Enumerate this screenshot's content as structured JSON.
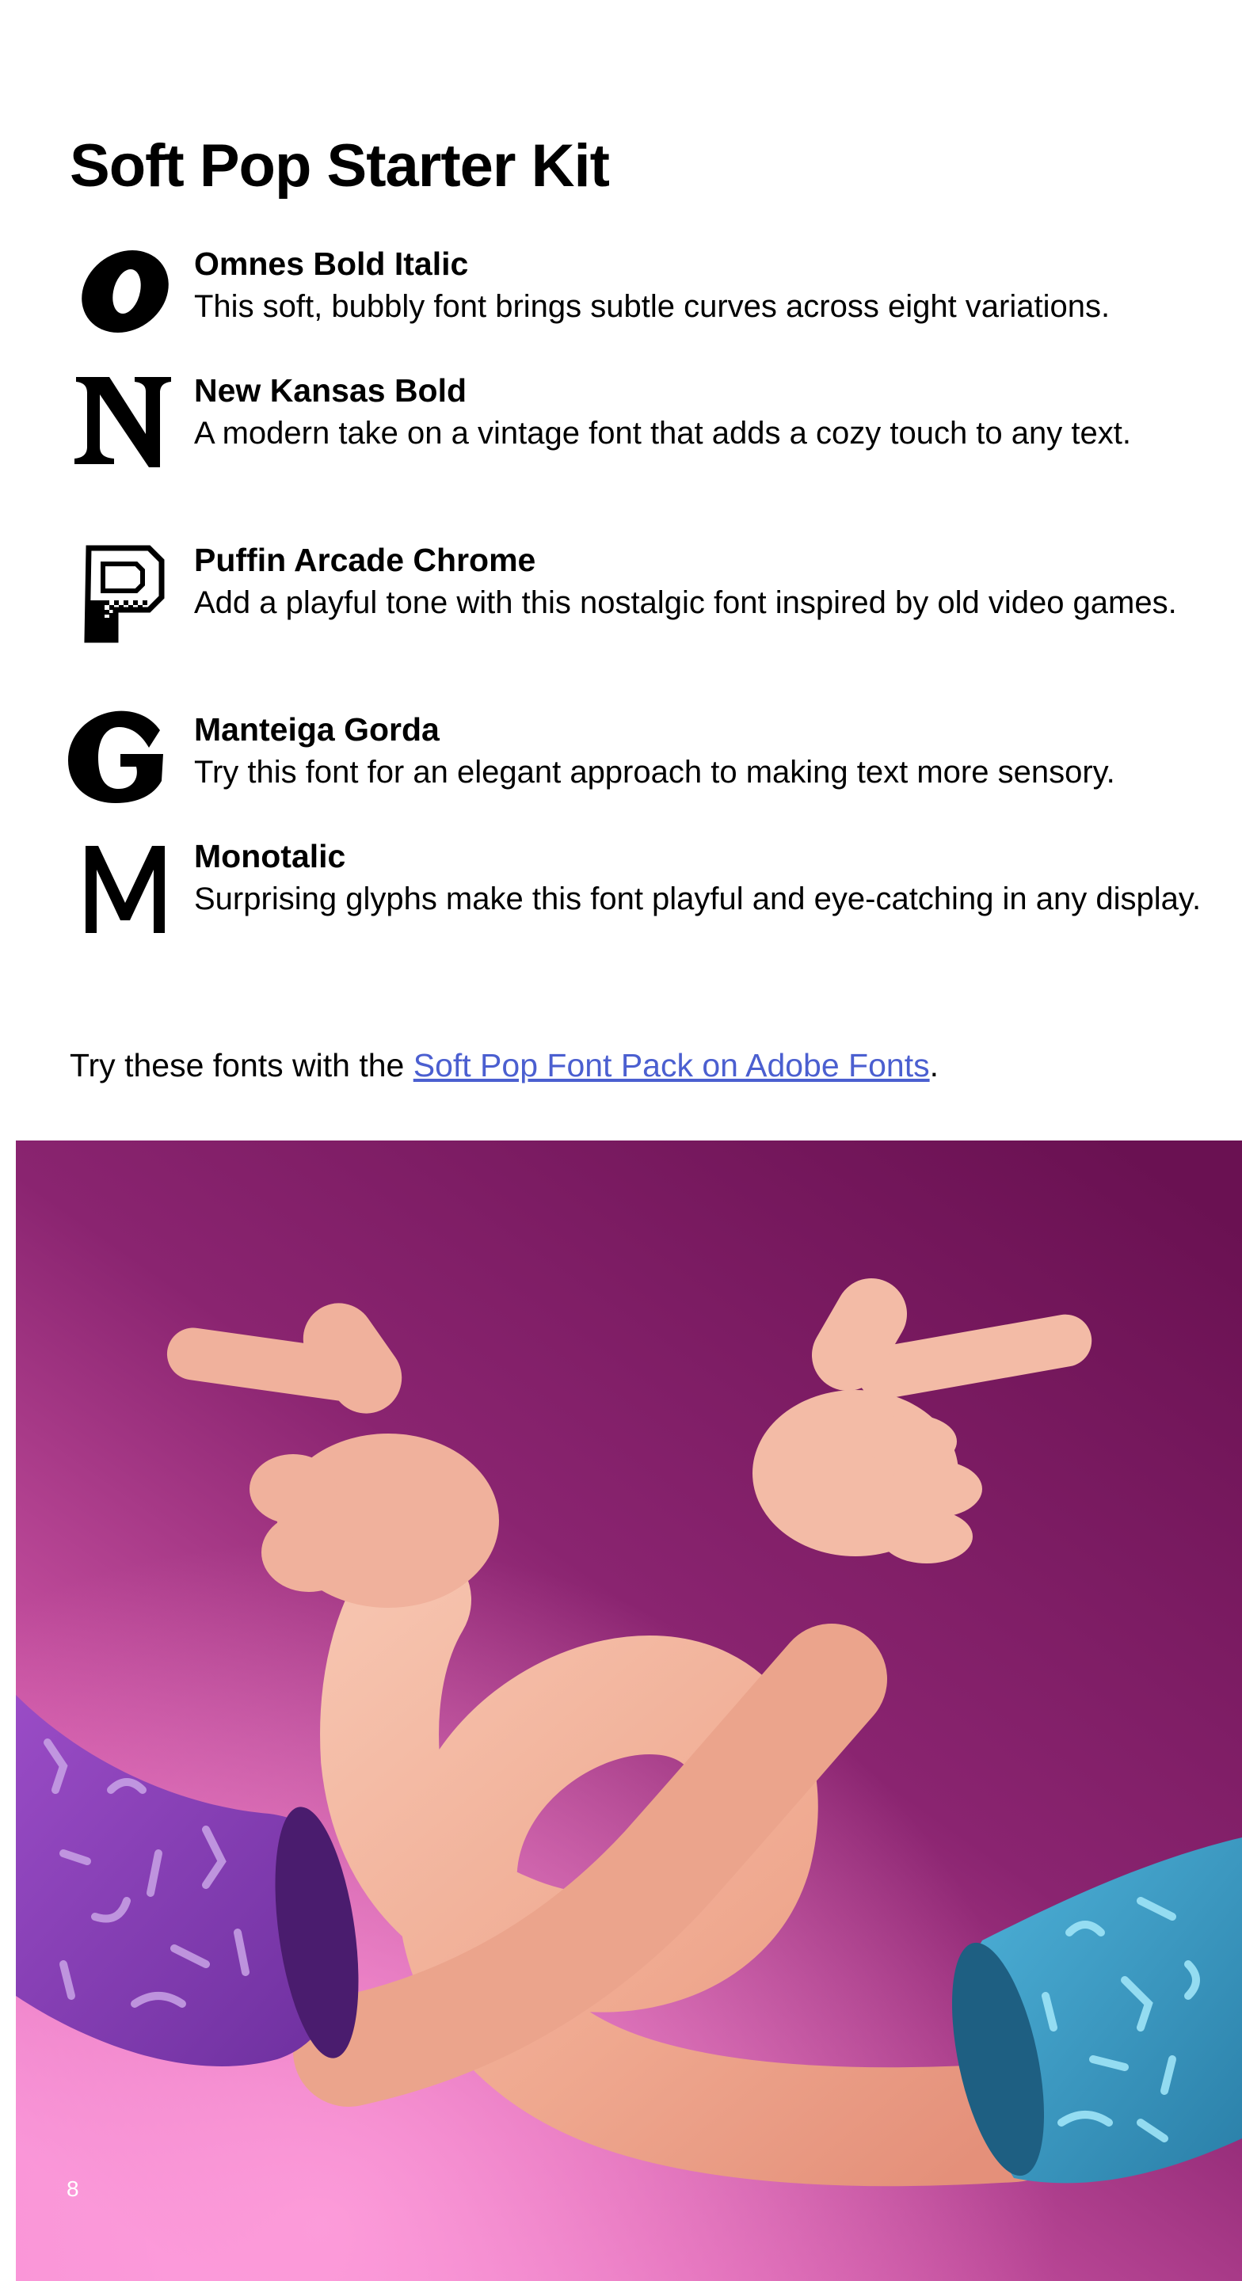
{
  "page": {
    "title": "Soft Pop Starter Kit",
    "page_number": "8"
  },
  "fonts": [
    {
      "glyph": "O",
      "name": "Omnes Bold Italic",
      "description": "This soft, bubbly font brings subtle curves across eight variations."
    },
    {
      "glyph": "N",
      "name": "New Kansas Bold",
      "description": "A modern take on a vintage font that adds a cozy touch to any text."
    },
    {
      "glyph": "P",
      "name": "Puffin Arcade Chrome",
      "description": "Add a playful tone with this nostalgic font inspired by old video games."
    },
    {
      "glyph": "G",
      "name": "Manteiga Gorda",
      "description": "Try this font for an elegant approach to making text more sensory."
    },
    {
      "glyph": "M",
      "name": "Monotalic",
      "description": "Surprising glyphs make this font playful and eye-catching in any display."
    }
  ],
  "cta": {
    "prefix": "Try these fonts with the ",
    "link_text": "Soft Pop Font Pack on Adobe Fonts",
    "suffix": "."
  },
  "colors": {
    "link": "#4b5fd0",
    "background_top": "#6e1456",
    "background_bottom": "#f28ad2",
    "skin": "#f2b09c",
    "left_sleeve": "#8a3fb8",
    "right_sleeve": "#3a9bc4"
  }
}
